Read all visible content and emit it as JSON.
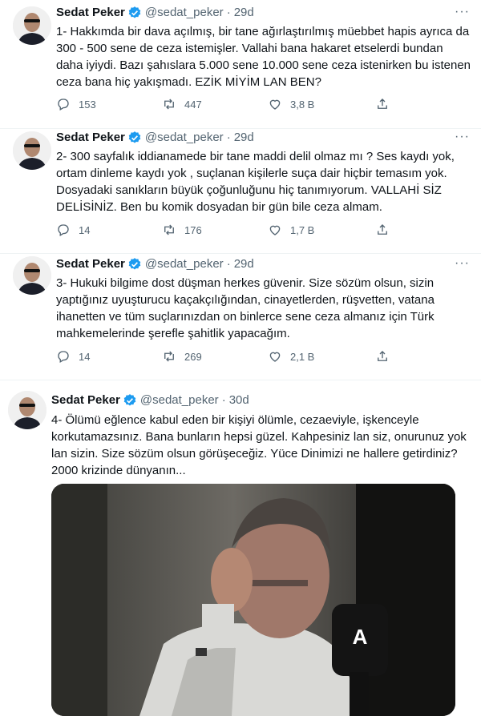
{
  "tweets": [
    {
      "name": "Sedat Peker",
      "handle": "@sedat_peker",
      "time": "29d",
      "text": "1- Hakkımda bir dava açılmış, bir tane ağırlaştırılmış müebbet hapis ayrıca da\n300 - 500 sene de ceza istemişler. Vallahi bana hakaret etselerdi bundan\ndaha iyiydi. Bazı şahıslara 5.000 sene 10.000 sene ceza istenirken bu istenen\nceza bana hiç yakışmadı. EZİK MİYİM LAN BEN?",
      "replies": "153",
      "retweets": "447",
      "likes": "3,8 B"
    },
    {
      "name": "Sedat Peker",
      "handle": "@sedat_peker",
      "time": "29d",
      "text": "2- 300 sayfalık iddianamede bir tane maddi delil olmaz mı ? Ses kaydı yok,\nortam dinleme kaydı yok , suçlanan kişilerle suça dair hiçbir temasım yok.\nDosyadaki sanıkların büyük çoğunluğunu hiç tanımıyorum. VALLAHİ SİZ\nDELİSİNİZ. Ben bu komik dosyadan bir gün bile ceza almam.",
      "replies": "14",
      "retweets": "176",
      "likes": "1,7 B"
    },
    {
      "name": "Sedat Peker",
      "handle": "@sedat_peker",
      "time": "29d",
      "text": "3- Hukuki bilgime dost düşman herkes güvenir. Size sözüm olsun, sizin\nyaptığınız uyuşturucu kaçakçılığından, cinayetlerden, rüşvetten, vatana\nihanetten ve tüm suçlarınızdan on binlerce sene ceza almanız için Türk\nmahkemelerinde şerefle şahitlik yapacağım.",
      "replies": "14",
      "retweets": "269",
      "likes": "2,1 B"
    },
    {
      "name": "Sedat Peker",
      "handle": "@sedat_peker",
      "time": "30d",
      "text": "4- Ölümü eğlence kabul eden bir kişiyi ölümle, cezaeviyle, işkenceyle\nkorkutamazsınız. Bana bunların hepsi güzel. Kahpesiniz lan siz, onurunuz yok\nlan sizin. Size sözüm olsun görüşeceğiz. Yüce Dinimizi ne hallere getirdiniz?\n2000 krizinde dünyanın...",
      "media_logo": "A"
    }
  ],
  "colors": {
    "verified": "#1d9bf0",
    "secondary_text": "#536471",
    "divider": "#eff3f4"
  },
  "icons": {
    "reply": "speech-bubble",
    "retweet": "two-arrows-loop",
    "like": "heart-outline",
    "share": "upload-arrow",
    "more": "three-dots",
    "verified": "verified-badge"
  }
}
